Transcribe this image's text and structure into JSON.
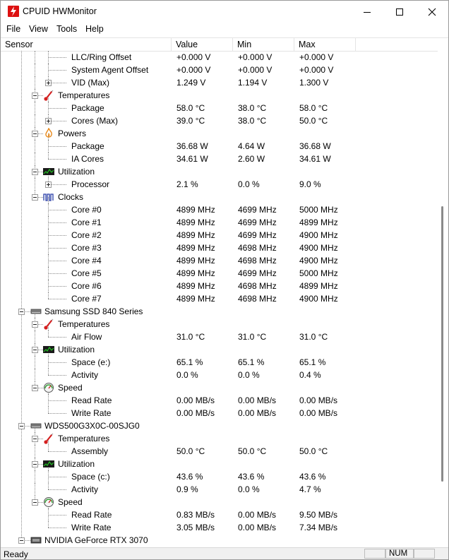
{
  "window": {
    "title": "CPUID HWMonitor"
  },
  "menu": [
    "File",
    "View",
    "Tools",
    "Help"
  ],
  "columns": [
    "Sensor",
    "Value",
    "Min",
    "Max"
  ],
  "rows": [
    {
      "level": 3,
      "label": "LLC/Ring Offset",
      "value": "+0.000 V",
      "min": "+0.000 V",
      "max": "+0.000 V"
    },
    {
      "level": 3,
      "label": "System Agent Offset",
      "value": "+0.000 V",
      "min": "+0.000 V",
      "max": "+0.000 V"
    },
    {
      "level": 3,
      "label": "VID (Max)",
      "value": "1.249 V",
      "min": "1.194 V",
      "max": "1.300 V",
      "expander": "plus",
      "last": true
    },
    {
      "level": 2,
      "label": "Temperatures",
      "icon": "thermometer-icon",
      "expander": "minus"
    },
    {
      "level": 3,
      "label": "Package",
      "value": "58.0 °C",
      "min": "38.0 °C",
      "max": "58.0 °C"
    },
    {
      "level": 3,
      "label": "Cores (Max)",
      "value": "39.0 °C",
      "min": "38.0 °C",
      "max": "50.0 °C",
      "expander": "plus",
      "last": true
    },
    {
      "level": 2,
      "label": "Powers",
      "icon": "power-flame-icon",
      "expander": "minus"
    },
    {
      "level": 3,
      "label": "Package",
      "value": "36.68 W",
      "min": "4.64 W",
      "max": "36.68 W"
    },
    {
      "level": 3,
      "label": "IA Cores",
      "value": "34.61 W",
      "min": "2.60 W",
      "max": "34.61 W",
      "last": true
    },
    {
      "level": 2,
      "label": "Utilization",
      "icon": "utilization-graph-icon",
      "expander": "minus"
    },
    {
      "level": 3,
      "label": "Processor",
      "value": "2.1 %",
      "min": "0.0 %",
      "max": "9.0 %",
      "expander": "plus",
      "last": true
    },
    {
      "level": 2,
      "label": "Clocks",
      "icon": "clock-wave-icon",
      "expander": "minus",
      "lastParent": true
    },
    {
      "level": 3,
      "label": "Core #0",
      "value": "4899 MHz",
      "min": "4699 MHz",
      "max": "5000 MHz"
    },
    {
      "level": 3,
      "label": "Core #1",
      "value": "4899 MHz",
      "min": "4699 MHz",
      "max": "4899 MHz"
    },
    {
      "level": 3,
      "label": "Core #2",
      "value": "4899 MHz",
      "min": "4699 MHz",
      "max": "4900 MHz"
    },
    {
      "level": 3,
      "label": "Core #3",
      "value": "4899 MHz",
      "min": "4698 MHz",
      "max": "4900 MHz"
    },
    {
      "level": 3,
      "label": "Core #4",
      "value": "4899 MHz",
      "min": "4698 MHz",
      "max": "4900 MHz"
    },
    {
      "level": 3,
      "label": "Core #5",
      "value": "4899 MHz",
      "min": "4699 MHz",
      "max": "5000 MHz"
    },
    {
      "level": 3,
      "label": "Core #6",
      "value": "4899 MHz",
      "min": "4698 MHz",
      "max": "4899 MHz"
    },
    {
      "level": 3,
      "label": "Core #7",
      "value": "4899 MHz",
      "min": "4698 MHz",
      "max": "4900 MHz",
      "last": true
    },
    {
      "level": 1,
      "label": "Samsung SSD 840 Series",
      "icon": "drive-icon",
      "expander": "minus"
    },
    {
      "level": 2,
      "label": "Temperatures",
      "icon": "thermometer-icon",
      "expander": "minus"
    },
    {
      "level": 3,
      "label": "Air Flow",
      "value": "31.0 °C",
      "min": "31.0 °C",
      "max": "31.0 °C",
      "last": true
    },
    {
      "level": 2,
      "label": "Utilization",
      "icon": "utilization-graph-icon",
      "expander": "minus"
    },
    {
      "level": 3,
      "label": "Space (e:)",
      "value": "65.1 %",
      "min": "65.1 %",
      "max": "65.1 %"
    },
    {
      "level": 3,
      "label": "Activity",
      "value": "0.0 %",
      "min": "0.0 %",
      "max": "0.4 %",
      "last": true
    },
    {
      "level": 2,
      "label": "Speed",
      "icon": "speedometer-icon",
      "expander": "minus",
      "lastParent": true
    },
    {
      "level": 3,
      "label": "Read Rate",
      "value": "0.00 MB/s",
      "min": "0.00 MB/s",
      "max": "0.00 MB/s"
    },
    {
      "level": 3,
      "label": "Write Rate",
      "value": "0.00 MB/s",
      "min": "0.00 MB/s",
      "max": "0.00 MB/s",
      "last": true
    },
    {
      "level": 1,
      "label": "WDS500G3X0C-00SJG0",
      "icon": "drive-icon",
      "expander": "minus"
    },
    {
      "level": 2,
      "label": "Temperatures",
      "icon": "thermometer-icon",
      "expander": "minus"
    },
    {
      "level": 3,
      "label": "Assembly",
      "value": "50.0 °C",
      "min": "50.0 °C",
      "max": "50.0 °C",
      "last": true
    },
    {
      "level": 2,
      "label": "Utilization",
      "icon": "utilization-graph-icon",
      "expander": "minus"
    },
    {
      "level": 3,
      "label": "Space (c:)",
      "value": "43.6 %",
      "min": "43.6 %",
      "max": "43.6 %"
    },
    {
      "level": 3,
      "label": "Activity",
      "value": "0.9 %",
      "min": "0.0 %",
      "max": "4.7 %",
      "last": true
    },
    {
      "level": 2,
      "label": "Speed",
      "icon": "speedometer-icon",
      "expander": "minus",
      "lastParent": true
    },
    {
      "level": 3,
      "label": "Read Rate",
      "value": "0.83 MB/s",
      "min": "0.00 MB/s",
      "max": "9.50 MB/s"
    },
    {
      "level": 3,
      "label": "Write Rate",
      "value": "3.05 MB/s",
      "min": "0.00 MB/s",
      "max": "7.34 MB/s",
      "last": true
    },
    {
      "level": 1,
      "label": "NVIDIA GeForce RTX 3070",
      "icon": "gpu-card-icon",
      "expander": "minus"
    }
  ],
  "status": {
    "text": "Ready",
    "num": "NUM"
  },
  "colors": {
    "thermometer": "#d42020",
    "power": "#e8891a",
    "util_bg": "#1a1a1a",
    "util_line": "#22c422",
    "clock": "#2a3fa8"
  }
}
